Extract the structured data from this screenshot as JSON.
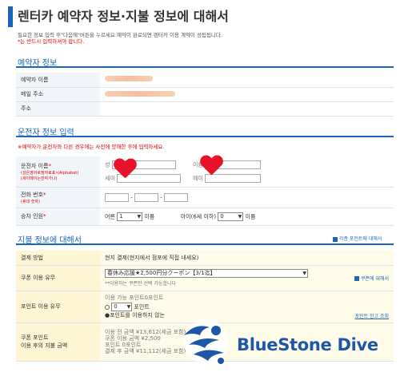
{
  "page": {
    "title": "렌터카 예약자 정보·지불 정보에 대해서",
    "intro_line1": "필요한 정보 입력 후\"다음에\"버튼을 누르세요.예약이 완료되면 렌터카 이용 계약이 성립됩니다.",
    "intro_line2": "*는 반드시 입력하셔야 합니다."
  },
  "reservation": {
    "title": "예약자 정보",
    "name_label": "예약자 이름",
    "email_label": "메일 주소",
    "address_label": "주소"
  },
  "driver": {
    "title": "운전자 정보 입력",
    "note": "※예약자가 운전자와 다른 경우에는 사전에 양해한 후에 입력하세요.",
    "name_label": "운전자 이름",
    "name_note1": "(성은영어로정자로표시Alphabet)",
    "name_note2": "(세이메이는한자가나)",
    "surname_label": "성",
    "given_label": "이름",
    "sei_label": "세이",
    "mei_label": "메이",
    "phone_label": "전화 번호",
    "phone_note": "(휴대 숫자)",
    "phone_sep": "-",
    "passengers_label": "승차 인원",
    "adult_label": "어른",
    "adult_value": "1",
    "adult_unit": "이름",
    "child_label": "아이(6세 이하)",
    "child_value": "0",
    "child_unit": "이름",
    "required_mark": "*"
  },
  "payment": {
    "title": "지불 정보에 대해서",
    "side_link": "각종 포인트에 대해서",
    "method_label": "결제 방법",
    "method_value": "현지 결제(현지에서 점포에 직접 내세요)",
    "coupon_label": "쿠폰 이용 유무",
    "coupon_value": "春休み応援★2,500円分クーポン【3/1迄】",
    "coupon_note": "**이용하는 쿠폰만 선택 가능합니다",
    "coupon_link": "쿠폰에 대해서",
    "points_label": "포인트 이용 유무",
    "points_available": "이용 가능 포인트0포인트",
    "points_value": "0",
    "points_unit": "포인트",
    "points_radio": "●포인트를 이용하지 않는",
    "points_link": "포인트 잔고 조회",
    "total_label1": "쿠폰 포인트",
    "total_label2": "이용 후의 지불 금액",
    "total_before": "이용 전 금액 ¥13,612(세금 포함)",
    "total_coupon": "쿠폰 이용 금액 ¥2,500",
    "total_points": "포인트 0포인트",
    "total_after": "결제 후 금액 ¥11,112(세금 포함)"
  },
  "watermark": {
    "text": "BlueStone Dive"
  },
  "colors": {
    "accent": "#1a66b8",
    "required": "#dd0000",
    "label_bg": "#f2f5f9",
    "payment_label_bg": "#fff6d6",
    "logo_blue": "#1e57a8",
    "heart": "#e8132a"
  }
}
